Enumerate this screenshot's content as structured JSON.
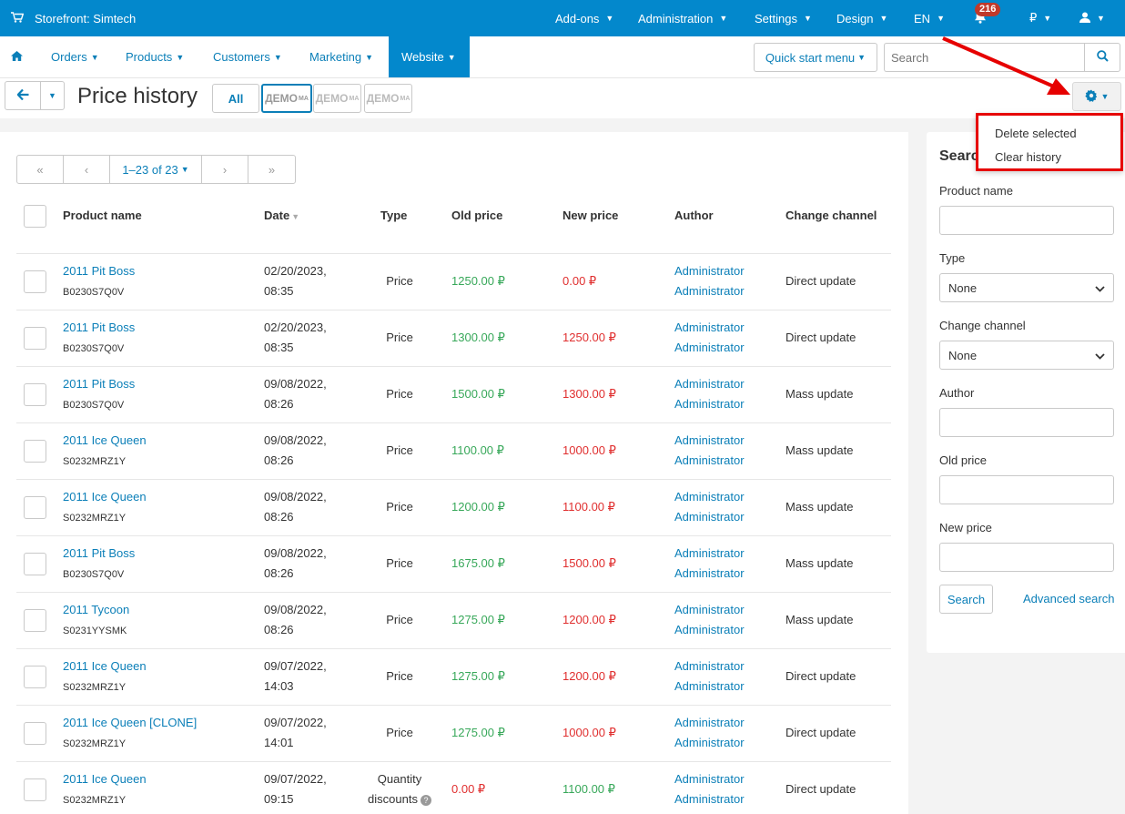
{
  "topbar": {
    "store_name": "Storefront: Simtech",
    "menus": [
      "Add-ons",
      "Administration",
      "Settings",
      "Design",
      "EN"
    ],
    "notification_count": "216",
    "currency": "₽"
  },
  "nav": {
    "items": [
      "Orders",
      "Products",
      "Customers",
      "Marketing",
      "Website"
    ],
    "active": "Website",
    "quick_start": "Quick start menu",
    "search_placeholder": "Search"
  },
  "toolbar": {
    "title": "Price history",
    "store_tabs": [
      "All",
      "ДЕМО",
      "ДЕМО",
      "ДЕМО"
    ],
    "store_tab_sup": "МА"
  },
  "dropdown": {
    "items": [
      "Delete selected",
      "Clear history"
    ]
  },
  "pager": {
    "first": "«",
    "prev": "‹",
    "range": "1–23 of 23",
    "next": "›",
    "last": "»"
  },
  "table": {
    "headers": [
      "Product name",
      "Date",
      "Type",
      "Old price",
      "New price",
      "Author",
      "Change channel"
    ],
    "rows": [
      {
        "name": "2011 Pit Boss",
        "code": "B0230S7Q0V",
        "date1": "02/20/2023,",
        "date2": "08:35",
        "type": "Price",
        "old": "1250.00 ₽",
        "new": "0.00 ₽",
        "author1": "Administrator",
        "author2": "Administrator",
        "channel": "Direct update"
      },
      {
        "name": "2011 Pit Boss",
        "code": "B0230S7Q0V",
        "date1": "02/20/2023,",
        "date2": "08:35",
        "type": "Price",
        "old": "1300.00 ₽",
        "new": "1250.00 ₽",
        "author1": "Administrator",
        "author2": "Administrator",
        "channel": "Direct update"
      },
      {
        "name": "2011 Pit Boss",
        "code": "B0230S7Q0V",
        "date1": "09/08/2022,",
        "date2": "08:26",
        "type": "Price",
        "old": "1500.00 ₽",
        "new": "1300.00 ₽",
        "author1": "Administrator",
        "author2": "Administrator",
        "channel": "Mass update"
      },
      {
        "name": "2011 Ice Queen",
        "code": "S0232MRZ1Y",
        "date1": "09/08/2022,",
        "date2": "08:26",
        "type": "Price",
        "old": "1100.00 ₽",
        "new": "1000.00 ₽",
        "author1": "Administrator",
        "author2": "Administrator",
        "channel": "Mass update"
      },
      {
        "name": "2011 Ice Queen",
        "code": "S0232MRZ1Y",
        "date1": "09/08/2022,",
        "date2": "08:26",
        "type": "Price",
        "old": "1200.00 ₽",
        "new": "1100.00 ₽",
        "author1": "Administrator",
        "author2": "Administrator",
        "channel": "Mass update"
      },
      {
        "name": "2011 Pit Boss",
        "code": "B0230S7Q0V",
        "date1": "09/08/2022,",
        "date2": "08:26",
        "type": "Price",
        "old": "1675.00 ₽",
        "new": "1500.00 ₽",
        "author1": "Administrator",
        "author2": "Administrator",
        "channel": "Mass update"
      },
      {
        "name": "2011 Tycoon",
        "code": "S0231YYSMK",
        "date1": "09/08/2022,",
        "date2": "08:26",
        "type": "Price",
        "old": "1275.00 ₽",
        "new": "1200.00 ₽",
        "author1": "Administrator",
        "author2": "Administrator",
        "channel": "Mass update"
      },
      {
        "name": "2011 Ice Queen",
        "code": "S0232MRZ1Y",
        "date1": "09/07/2022,",
        "date2": "14:03",
        "type": "Price",
        "old": "1275.00 ₽",
        "new": "1200.00 ₽",
        "author1": "Administrator",
        "author2": "Administrator",
        "channel": "Direct update"
      },
      {
        "name": "2011 Ice Queen [CLONE]",
        "code": "S0232MRZ1Y",
        "date1": "09/07/2022,",
        "date2": "14:01",
        "type": "Price",
        "old": "1275.00 ₽",
        "new": "1000.00 ₽",
        "author1": "Administrator",
        "author2": "Administrator",
        "channel": "Direct update"
      },
      {
        "name": "2011 Ice Queen",
        "code": "S0232MRZ1Y",
        "date1": "09/07/2022,",
        "date2": "09:15",
        "type1": "Quantity",
        "type2": "discounts",
        "old": "0.00 ₽",
        "new": "1100.00 ₽",
        "author1": "Administrator",
        "author2": "Administrator",
        "channel": "Direct update"
      }
    ]
  },
  "sidebar": {
    "title": "Search",
    "product_name_label": "Product name",
    "type_label": "Type",
    "type_value": "None",
    "channel_label": "Change channel",
    "channel_value": "None",
    "author_label": "Author",
    "old_price_label": "Old price",
    "new_price_label": "New price",
    "search_button": "Search",
    "advanced_search": "Advanced search"
  },
  "colors": {
    "brand": "#0388cc",
    "link": "#0b7fb8",
    "old_price": "#38a85a",
    "new_price": "#e02f2f",
    "highlight": "#e60000"
  }
}
